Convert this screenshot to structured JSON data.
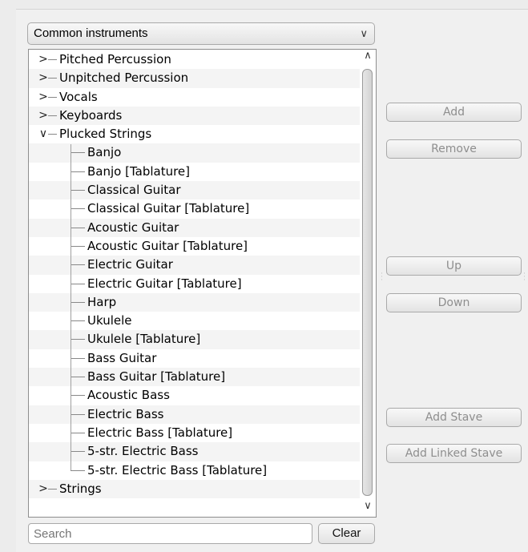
{
  "category_select": {
    "value": "Common instruments"
  },
  "tree": {
    "rows": [
      {
        "label": "Pitched Percussion",
        "level": 0,
        "expander": "collapsed"
      },
      {
        "label": "Unpitched Percussion",
        "level": 0,
        "expander": "collapsed"
      },
      {
        "label": "Vocals",
        "level": 0,
        "expander": "collapsed"
      },
      {
        "label": "Keyboards",
        "level": 0,
        "expander": "collapsed"
      },
      {
        "label": "Plucked Strings",
        "level": 0,
        "expander": "expanded"
      },
      {
        "label": "Banjo",
        "level": 1
      },
      {
        "label": "Banjo [Tablature]",
        "level": 1
      },
      {
        "label": "Classical Guitar",
        "level": 1
      },
      {
        "label": "Classical Guitar [Tablature]",
        "level": 1
      },
      {
        "label": "Acoustic Guitar",
        "level": 1
      },
      {
        "label": "Acoustic Guitar [Tablature]",
        "level": 1
      },
      {
        "label": "Electric Guitar",
        "level": 1
      },
      {
        "label": "Electric Guitar [Tablature]",
        "level": 1
      },
      {
        "label": "Harp",
        "level": 1
      },
      {
        "label": "Ukulele",
        "level": 1
      },
      {
        "label": "Ukulele [Tablature]",
        "level": 1
      },
      {
        "label": "Bass Guitar",
        "level": 1
      },
      {
        "label": "Bass Guitar [Tablature]",
        "level": 1
      },
      {
        "label": "Acoustic Bass",
        "level": 1
      },
      {
        "label": "Electric Bass",
        "level": 1
      },
      {
        "label": "Electric Bass [Tablature]",
        "level": 1
      },
      {
        "label": "5-str. Electric Bass",
        "level": 1
      },
      {
        "label": "5-str. Electric Bass [Tablature]",
        "level": 1
      },
      {
        "label": "Strings",
        "level": 0,
        "expander": "collapsed"
      }
    ]
  },
  "search": {
    "placeholder": "Search"
  },
  "buttons": {
    "clear": "Clear",
    "add": "Add",
    "remove": "Remove",
    "up": "Up",
    "down": "Down",
    "add_stave": "Add Stave",
    "add_linked_stave": "Add Linked Stave"
  }
}
